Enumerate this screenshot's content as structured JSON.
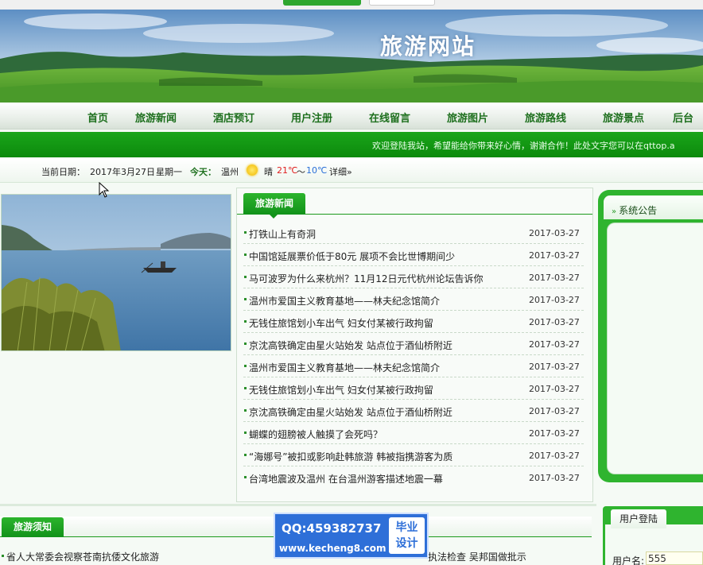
{
  "site": {
    "title": "旅游网站"
  },
  "nav": {
    "items": [
      "首页",
      "旅游新闻",
      "酒店预订",
      "用户注册",
      "在线留言",
      "旅游图片",
      "旅游路线",
      "旅游景点",
      "后台"
    ]
  },
  "welcome": {
    "text": "欢迎登陆我站，希望能给你带来好心情，谢谢合作！此处文字您可以在qttop.a"
  },
  "datebar": {
    "date_label": "当前日期：",
    "date": "2017年3月27日",
    "weekday": "星期一",
    "today_label": "今天：",
    "city": "温州",
    "weather": "晴",
    "temp_high": "21℃",
    "temp_sep": "～",
    "temp_low": "10℃",
    "detail": "详细»"
  },
  "news": {
    "tab": "旅游新闻",
    "items": [
      {
        "title": "打铁山上有奇洞",
        "date": "2017-03-27"
      },
      {
        "title": "中国馆延展票价低于80元 展项不会比世博期间少",
        "date": "2017-03-27"
      },
      {
        "title": "马可波罗为什么来杭州？11月12日元代杭州论坛告诉你",
        "date": "2017-03-27"
      },
      {
        "title": "温州市爱国主义教育基地——林夫纪念馆简介",
        "date": "2017-03-27"
      },
      {
        "title": "无钱住旅馆划小车出气 妇女付某被行政拘留",
        "date": "2017-03-27"
      },
      {
        "title": "京沈高铁确定由星火站始发 站点位于酒仙桥附近",
        "date": "2017-03-27"
      },
      {
        "title": "温州市爱国主义教育基地——林夫纪念馆简介",
        "date": "2017-03-27"
      },
      {
        "title": "无钱住旅馆划小车出气 妇女付某被行政拘留",
        "date": "2017-03-27"
      },
      {
        "title": "京沈高铁确定由星火站始发 站点位于酒仙桥附近",
        "date": "2017-03-27"
      },
      {
        "title": "蝴蝶的翅膀被人触摸了会死吗？",
        "date": "2017-03-27"
      },
      {
        "title": "“海娜号”被扣或影响赴韩旅游 韩被指携游客为质",
        "date": "2017-03-27"
      },
      {
        "title": "台湾地震波及温州 在台温州游客描述地震一幕",
        "date": "2017-03-27"
      }
    ]
  },
  "notice": {
    "title": "系统公告"
  },
  "notes": {
    "tab": "旅游须知",
    "item_left": "省人大常委会视察苍南抗倭文化旅游",
    "item_right": "执法检查 吴邦国做批示"
  },
  "login": {
    "tab": "用户登陆",
    "username_label": "用户名:",
    "username_value": "555"
  },
  "watermark": {
    "qq": "QQ:459382737",
    "site": "www.kecheng8.com",
    "badge_line1": "毕业",
    "badge_line2": "设计"
  },
  "icons": {
    "weather": "sun-icon",
    "cursor": "mouse-pointer-icon"
  },
  "colors": {
    "brand_green": "#12921a",
    "nav_text": "#1d6f1d",
    "temp_high": "#e02020",
    "temp_low": "#2a6fd8",
    "today_label": "#1d6f1d"
  }
}
